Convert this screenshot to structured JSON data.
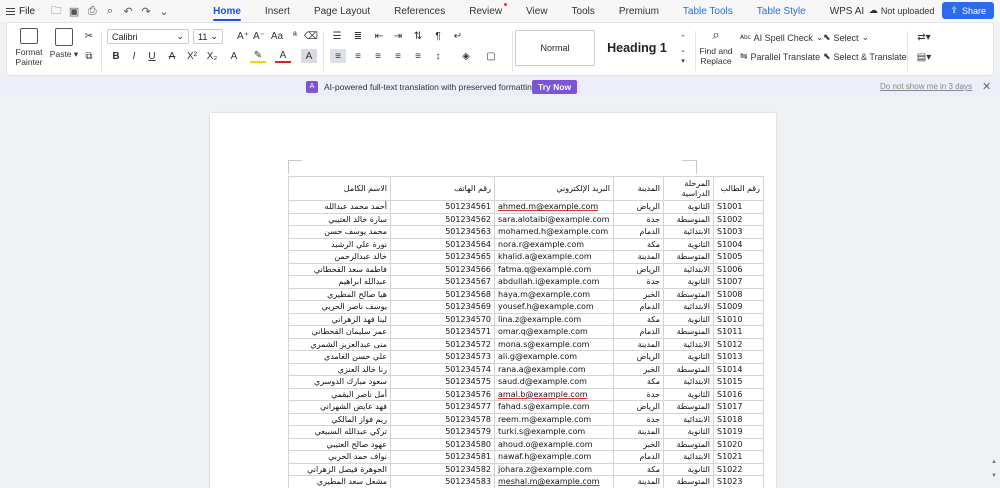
{
  "menubar": {
    "file_label": "File",
    "tabs": [
      "Home",
      "Insert",
      "Page Layout",
      "References",
      "Review",
      "View",
      "Tools",
      "Premium",
      "Table Tools",
      "Table Style",
      "WPS AI"
    ],
    "status": "Not uploaded",
    "share_label": "Share"
  },
  "ribbon": {
    "format_painter": "Format\nPainter",
    "paste": "Paste",
    "font_name": "Calibri",
    "font_size": "11",
    "style_normal": "Normal",
    "style_heading1": "Heading 1",
    "find_replace": "Find and\nReplace",
    "ai_spell_check": "AI Spell Check",
    "parallel_translate": "Parallel Translate",
    "select": "Select",
    "select_translate": "Select & Translate"
  },
  "translation_bar": {
    "icon_text": "A",
    "message": "AI-powered full-text translation with preserved formatting.",
    "button": "Try Now",
    "dismiss": "Do not show me in 3 days"
  },
  "table": {
    "headers": {
      "name": "الاسم الكامل",
      "phone": "رقم الهاتف",
      "email": "البريد الإلكتروني",
      "city": "المدينة",
      "stage": "المرحلة الدراسية",
      "id": "رقم الطالب"
    },
    "rows": [
      {
        "name": "أحمد محمد عبدالله",
        "phone": "501234561",
        "email": "ahmed.m@example.com",
        "city": "الرياض",
        "stage": "الثانوية",
        "id": "S1001"
      },
      {
        "name": "سارة خالد العتيبي",
        "phone": "501234562",
        "email": "sara.alotaibi@example.com",
        "city": "جدة",
        "stage": "المتوسطة",
        "id": "S1002"
      },
      {
        "name": "محمد يوسف حسن",
        "phone": "501234563",
        "email": "mohamed.h@example.com",
        "city": "الدمام",
        "stage": "الابتدائية",
        "id": "S1003"
      },
      {
        "name": "نورة علي الرشيد",
        "phone": "501234564",
        "email": "nora.r@example.com",
        "city": "مكة",
        "stage": "الثانوية",
        "id": "S1004"
      },
      {
        "name": "خالد عبدالرحمن",
        "phone": "501234565",
        "email": "khalid.a@example.com",
        "city": "المدينة",
        "stage": "المتوسطة",
        "id": "S1005"
      },
      {
        "name": "فاطمة سعد القحطاني",
        "phone": "501234566",
        "email": "fatma.q@example.com",
        "city": "الرياض",
        "stage": "الابتدائية",
        "id": "S1006"
      },
      {
        "name": "عبدالله ابراهيم",
        "phone": "501234567",
        "email": "abdullah.i@example.com",
        "city": "جدة",
        "stage": "الثانوية",
        "id": "S1007"
      },
      {
        "name": "هيا صالح المطيري",
        "phone": "501234568",
        "email": "haya.m@example.com",
        "city": "الخبر",
        "stage": "المتوسطة",
        "id": "S1008"
      },
      {
        "name": "يوسف ناصر الحربي",
        "phone": "501234569",
        "email": "yousef.h@example.com",
        "city": "الدمام",
        "stage": "الابتدائية",
        "id": "S1009"
      },
      {
        "name": "لينا فهد الزهراني",
        "phone": "501234570",
        "email": "lina.z@example.com",
        "city": "مكة",
        "stage": "الثانوية",
        "id": "S1010"
      },
      {
        "name": "عمر سليمان القحطاني",
        "phone": "501234571",
        "email": "omar.q@example.com",
        "city": "الدمام",
        "stage": "المتوسطة",
        "id": "S1011"
      },
      {
        "name": "منى عبدالعزيز الشمري",
        "phone": "501234572",
        "email": "mona.s@example.com",
        "city": "المدينة",
        "stage": "الابتدائية",
        "id": "S1012"
      },
      {
        "name": "علي حسن الغامدي",
        "phone": "501234573",
        "email": "ali.g@example.com",
        "city": "الرياض",
        "stage": "الثانوية",
        "id": "S1013"
      },
      {
        "name": "رنا خالد العنزي",
        "phone": "501234574",
        "email": "rana.a@example.com",
        "city": "الخبر",
        "stage": "المتوسطة",
        "id": "S1014"
      },
      {
        "name": "سعود مبارك الدوسري",
        "phone": "501234575",
        "email": "saud.d@example.com",
        "city": "مكة",
        "stage": "الابتدائية",
        "id": "S1015"
      },
      {
        "name": "أمل ناصر البقمي",
        "phone": "501234576",
        "email": "amal.b@example.com",
        "city": "جدة",
        "stage": "الثانوية",
        "id": "S1016"
      },
      {
        "name": "فهد عايض الشهراني",
        "phone": "501234577",
        "email": "fahad.s@example.com",
        "city": "الرياض",
        "stage": "المتوسطة",
        "id": "S1017"
      },
      {
        "name": "ريم فواز المالكي",
        "phone": "501234578",
        "email": "reem.m@example.com",
        "city": "جدة",
        "stage": "الابتدائية",
        "id": "S1018"
      },
      {
        "name": "تركي عبدالله السبيعي",
        "phone": "501234579",
        "email": "turki.s@example.com",
        "city": "المدينة",
        "stage": "الثانوية",
        "id": "S1019"
      },
      {
        "name": "عهود صالح العتيبي",
        "phone": "501234580",
        "email": "ahoud.o@example.com",
        "city": "الخبر",
        "stage": "المتوسطة",
        "id": "S1020"
      },
      {
        "name": "نواف حمد الحربي",
        "phone": "501234581",
        "email": "nawaf.h@example.com",
        "city": "الدمام",
        "stage": "الابتدائية",
        "id": "S1021"
      },
      {
        "name": "الجوهرة فيصل الزهراني",
        "phone": "501234582",
        "email": "johara.z@example.com",
        "city": "مكة",
        "stage": "الثانوية",
        "id": "S1022"
      },
      {
        "name": "مشعل سعد المطيري",
        "phone": "501234583",
        "email": "meshal.m@example.com",
        "city": "المدينة",
        "stage": "المتوسطة",
        "id": "S1023"
      }
    ]
  }
}
